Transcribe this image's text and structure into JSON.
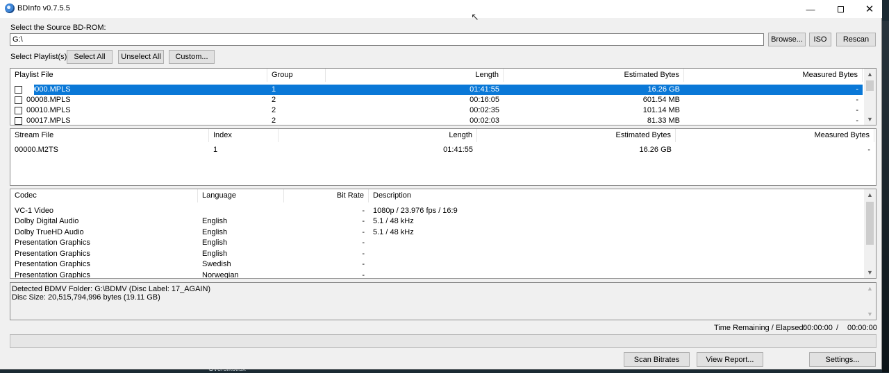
{
  "window": {
    "title": "BDInfo v0.7.5.5"
  },
  "desktop": {
    "stray_text": "Oversiktxlsx"
  },
  "source": {
    "label": "Select the Source BD-ROM:",
    "path": "G:\\"
  },
  "source_buttons": {
    "browse": "Browse...",
    "iso": "ISO",
    "rescan": "Rescan"
  },
  "playlist_select": {
    "label": "Select Playlist(s):",
    "select_all": "Select All",
    "unselect_all": "Unselect All",
    "custom": "Custom..."
  },
  "playlists": {
    "headers": [
      "Playlist File",
      "Group",
      "Length",
      "Estimated Bytes",
      "Measured Bytes"
    ],
    "rows": [
      {
        "file": "00000.MPLS",
        "group": "1",
        "length": "01:41:55",
        "est": "16.26 GB",
        "measured": "-",
        "selected": true
      },
      {
        "file": "00008.MPLS",
        "group": "2",
        "length": "00:16:05",
        "est": "601.54 MB",
        "measured": "-",
        "selected": false
      },
      {
        "file": "00010.MPLS",
        "group": "2",
        "length": "00:02:35",
        "est": "101.14 MB",
        "measured": "-",
        "selected": false
      },
      {
        "file": "00017.MPLS",
        "group": "2",
        "length": "00:02:03",
        "est": "81.33 MB",
        "measured": "-",
        "selected": false
      }
    ]
  },
  "streams": {
    "headers": [
      "Stream File",
      "Index",
      "Length",
      "Estimated Bytes",
      "Measured Bytes"
    ],
    "rows": [
      {
        "file": "00000.M2TS",
        "index": "1",
        "length": "01:41:55",
        "est": "16.26 GB",
        "measured": "-"
      }
    ]
  },
  "codecs": {
    "headers": [
      "Codec",
      "Language",
      "Bit Rate",
      "Description"
    ],
    "rows": [
      {
        "codec": "VC-1 Video",
        "language": "",
        "bitrate": "-",
        "desc": "1080p / 23.976 fps / 16:9"
      },
      {
        "codec": "Dolby Digital Audio",
        "language": "English",
        "bitrate": "-",
        "desc": "5.1 / 48 kHz"
      },
      {
        "codec": "Dolby TrueHD Audio",
        "language": "English",
        "bitrate": "-",
        "desc": "5.1 / 48 kHz"
      },
      {
        "codec": "Presentation Graphics",
        "language": "English",
        "bitrate": "-",
        "desc": ""
      },
      {
        "codec": "Presentation Graphics",
        "language": "English",
        "bitrate": "-",
        "desc": ""
      },
      {
        "codec": "Presentation Graphics",
        "language": "Swedish",
        "bitrate": "-",
        "desc": ""
      },
      {
        "codec": "Presentation Graphics",
        "language": "Norwegian",
        "bitrate": "-",
        "desc": ""
      }
    ]
  },
  "info": {
    "line1": "Detected BDMV Folder: G:\\BDMV (Disc Label: 17_AGAIN)",
    "line2": "Disc Size: 20,515,794,996 bytes (19.11 GB)"
  },
  "time": {
    "label": "Time Remaining / Elapsed:",
    "remaining": "00:00:00",
    "separator": "/",
    "elapsed": "00:00:00"
  },
  "progress": {
    "fraction": 0
  },
  "bottom_buttons": {
    "scan_bitrates": "Scan Bitrates",
    "view_report": "View Report...",
    "settings": "Settings..."
  },
  "colors": {
    "selection": "#0a78d7",
    "window_bg": "#f0f0f0"
  }
}
